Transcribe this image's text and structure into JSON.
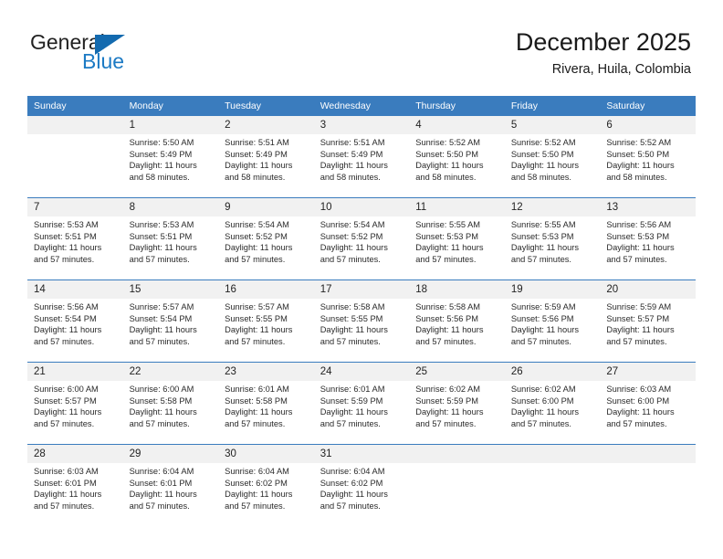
{
  "brand": {
    "name_part1": "General",
    "name_part2": "Blue",
    "triangle_color": "#136aaf",
    "blue_color": "#1c7ac4"
  },
  "header": {
    "title": "December 2025",
    "subtitle": "Rivera, Huila, Colombia",
    "accent_color": "#3a7cbe"
  },
  "weekday_headers": [
    "Sunday",
    "Monday",
    "Tuesday",
    "Wednesday",
    "Thursday",
    "Friday",
    "Saturday"
  ],
  "labels": {
    "sunrise_prefix": "Sunrise:",
    "sunset_prefix": "Sunset:",
    "daylight_prefix": "Daylight:"
  },
  "weeks": [
    [
      {
        "day": "",
        "line1": "",
        "line2": "",
        "line3": "",
        "line4": ""
      },
      {
        "day": "1",
        "line1": "Sunrise: 5:50 AM",
        "line2": "Sunset: 5:49 PM",
        "line3": "Daylight: 11 hours",
        "line4": "and 58 minutes."
      },
      {
        "day": "2",
        "line1": "Sunrise: 5:51 AM",
        "line2": "Sunset: 5:49 PM",
        "line3": "Daylight: 11 hours",
        "line4": "and 58 minutes."
      },
      {
        "day": "3",
        "line1": "Sunrise: 5:51 AM",
        "line2": "Sunset: 5:49 PM",
        "line3": "Daylight: 11 hours",
        "line4": "and 58 minutes."
      },
      {
        "day": "4",
        "line1": "Sunrise: 5:52 AM",
        "line2": "Sunset: 5:50 PM",
        "line3": "Daylight: 11 hours",
        "line4": "and 58 minutes."
      },
      {
        "day": "5",
        "line1": "Sunrise: 5:52 AM",
        "line2": "Sunset: 5:50 PM",
        "line3": "Daylight: 11 hours",
        "line4": "and 58 minutes."
      },
      {
        "day": "6",
        "line1": "Sunrise: 5:52 AM",
        "line2": "Sunset: 5:50 PM",
        "line3": "Daylight: 11 hours",
        "line4": "and 58 minutes."
      }
    ],
    [
      {
        "day": "7",
        "line1": "Sunrise: 5:53 AM",
        "line2": "Sunset: 5:51 PM",
        "line3": "Daylight: 11 hours",
        "line4": "and 57 minutes."
      },
      {
        "day": "8",
        "line1": "Sunrise: 5:53 AM",
        "line2": "Sunset: 5:51 PM",
        "line3": "Daylight: 11 hours",
        "line4": "and 57 minutes."
      },
      {
        "day": "9",
        "line1": "Sunrise: 5:54 AM",
        "line2": "Sunset: 5:52 PM",
        "line3": "Daylight: 11 hours",
        "line4": "and 57 minutes."
      },
      {
        "day": "10",
        "line1": "Sunrise: 5:54 AM",
        "line2": "Sunset: 5:52 PM",
        "line3": "Daylight: 11 hours",
        "line4": "and 57 minutes."
      },
      {
        "day": "11",
        "line1": "Sunrise: 5:55 AM",
        "line2": "Sunset: 5:53 PM",
        "line3": "Daylight: 11 hours",
        "line4": "and 57 minutes."
      },
      {
        "day": "12",
        "line1": "Sunrise: 5:55 AM",
        "line2": "Sunset: 5:53 PM",
        "line3": "Daylight: 11 hours",
        "line4": "and 57 minutes."
      },
      {
        "day": "13",
        "line1": "Sunrise: 5:56 AM",
        "line2": "Sunset: 5:53 PM",
        "line3": "Daylight: 11 hours",
        "line4": "and 57 minutes."
      }
    ],
    [
      {
        "day": "14",
        "line1": "Sunrise: 5:56 AM",
        "line2": "Sunset: 5:54 PM",
        "line3": "Daylight: 11 hours",
        "line4": "and 57 minutes."
      },
      {
        "day": "15",
        "line1": "Sunrise: 5:57 AM",
        "line2": "Sunset: 5:54 PM",
        "line3": "Daylight: 11 hours",
        "line4": "and 57 minutes."
      },
      {
        "day": "16",
        "line1": "Sunrise: 5:57 AM",
        "line2": "Sunset: 5:55 PM",
        "line3": "Daylight: 11 hours",
        "line4": "and 57 minutes."
      },
      {
        "day": "17",
        "line1": "Sunrise: 5:58 AM",
        "line2": "Sunset: 5:55 PM",
        "line3": "Daylight: 11 hours",
        "line4": "and 57 minutes."
      },
      {
        "day": "18",
        "line1": "Sunrise: 5:58 AM",
        "line2": "Sunset: 5:56 PM",
        "line3": "Daylight: 11 hours",
        "line4": "and 57 minutes."
      },
      {
        "day": "19",
        "line1": "Sunrise: 5:59 AM",
        "line2": "Sunset: 5:56 PM",
        "line3": "Daylight: 11 hours",
        "line4": "and 57 minutes."
      },
      {
        "day": "20",
        "line1": "Sunrise: 5:59 AM",
        "line2": "Sunset: 5:57 PM",
        "line3": "Daylight: 11 hours",
        "line4": "and 57 minutes."
      }
    ],
    [
      {
        "day": "21",
        "line1": "Sunrise: 6:00 AM",
        "line2": "Sunset: 5:57 PM",
        "line3": "Daylight: 11 hours",
        "line4": "and 57 minutes."
      },
      {
        "day": "22",
        "line1": "Sunrise: 6:00 AM",
        "line2": "Sunset: 5:58 PM",
        "line3": "Daylight: 11 hours",
        "line4": "and 57 minutes."
      },
      {
        "day": "23",
        "line1": "Sunrise: 6:01 AM",
        "line2": "Sunset: 5:58 PM",
        "line3": "Daylight: 11 hours",
        "line4": "and 57 minutes."
      },
      {
        "day": "24",
        "line1": "Sunrise: 6:01 AM",
        "line2": "Sunset: 5:59 PM",
        "line3": "Daylight: 11 hours",
        "line4": "and 57 minutes."
      },
      {
        "day": "25",
        "line1": "Sunrise: 6:02 AM",
        "line2": "Sunset: 5:59 PM",
        "line3": "Daylight: 11 hours",
        "line4": "and 57 minutes."
      },
      {
        "day": "26",
        "line1": "Sunrise: 6:02 AM",
        "line2": "Sunset: 6:00 PM",
        "line3": "Daylight: 11 hours",
        "line4": "and 57 minutes."
      },
      {
        "day": "27",
        "line1": "Sunrise: 6:03 AM",
        "line2": "Sunset: 6:00 PM",
        "line3": "Daylight: 11 hours",
        "line4": "and 57 minutes."
      }
    ],
    [
      {
        "day": "28",
        "line1": "Sunrise: 6:03 AM",
        "line2": "Sunset: 6:01 PM",
        "line3": "Daylight: 11 hours",
        "line4": "and 57 minutes."
      },
      {
        "day": "29",
        "line1": "Sunrise: 6:04 AM",
        "line2": "Sunset: 6:01 PM",
        "line3": "Daylight: 11 hours",
        "line4": "and 57 minutes."
      },
      {
        "day": "30",
        "line1": "Sunrise: 6:04 AM",
        "line2": "Sunset: 6:02 PM",
        "line3": "Daylight: 11 hours",
        "line4": "and 57 minutes."
      },
      {
        "day": "31",
        "line1": "Sunrise: 6:04 AM",
        "line2": "Sunset: 6:02 PM",
        "line3": "Daylight: 11 hours",
        "line4": "and 57 minutes."
      },
      {
        "day": "",
        "line1": "",
        "line2": "",
        "line3": "",
        "line4": ""
      },
      {
        "day": "",
        "line1": "",
        "line2": "",
        "line3": "",
        "line4": ""
      },
      {
        "day": "",
        "line1": "",
        "line2": "",
        "line3": "",
        "line4": ""
      }
    ]
  ]
}
